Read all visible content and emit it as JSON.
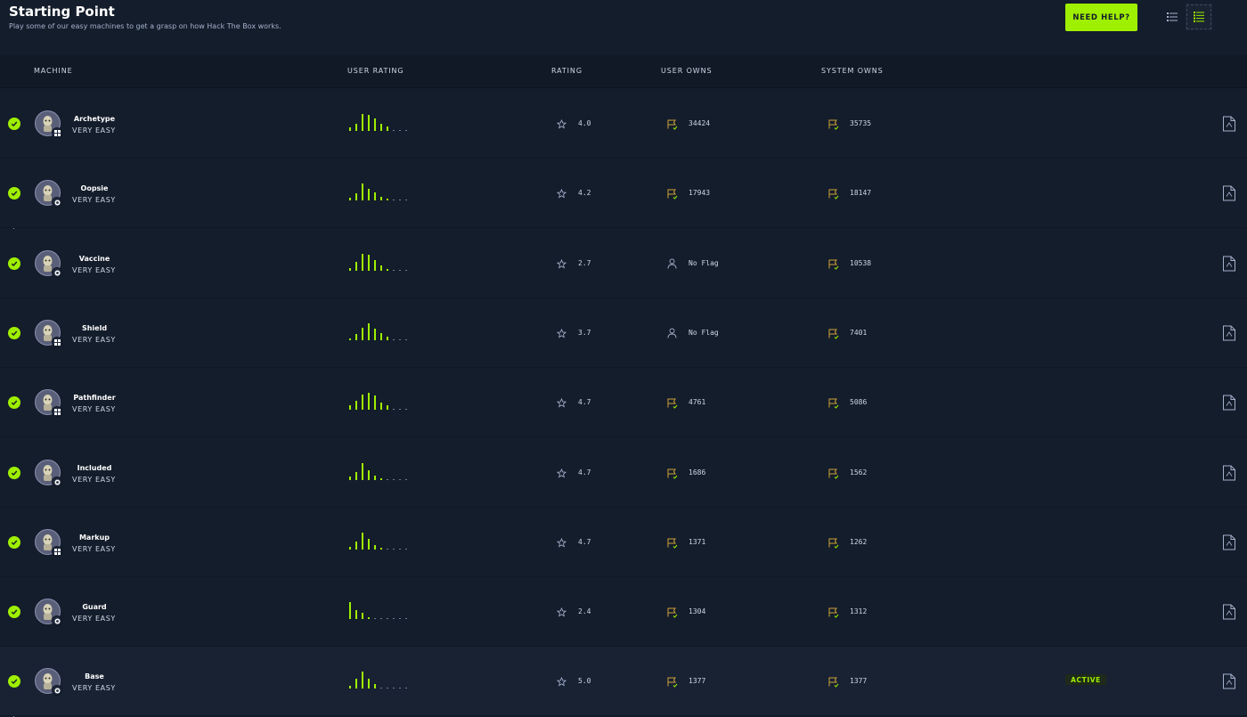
{
  "header": {
    "title": "Starting Point",
    "subtitle": "Play some of our easy machines to get a grasp on how Hack The Box works.",
    "help_label": "NEED HELP?"
  },
  "table": {
    "columns": [
      "MACHINE",
      "USER RATING",
      "RATING",
      "USER OWNS",
      "SYSTEM OWNS"
    ]
  },
  "colors": {
    "accent": "#9fef00",
    "background": "#141d2b",
    "flag": "#cfa23a"
  },
  "machines": [
    {
      "name": "Archetype",
      "difficulty": "VERY EASY",
      "os": "windows",
      "rating": "4.0",
      "user_owns": "34424",
      "user_flag": true,
      "system_owns": "35735",
      "active": false,
      "rating_distribution": [
        0.22,
        0.4,
        0.95,
        0.9,
        0.7,
        0.4,
        0.25,
        0,
        0,
        0
      ]
    },
    {
      "name": "Oopsie",
      "difficulty": "VERY EASY",
      "os": "linux",
      "rating": "4.2",
      "user_owns": "17943",
      "user_flag": true,
      "system_owns": "18147",
      "active": false,
      "rating_distribution": [
        0.15,
        0.4,
        0.95,
        0.65,
        0.45,
        0.2,
        0.1,
        0,
        0,
        0
      ]
    },
    {
      "name": "Vaccine",
      "difficulty": "VERY EASY",
      "os": "linux",
      "rating": "2.7",
      "user_owns": "No Flag",
      "user_flag": false,
      "system_owns": "10538",
      "active": false,
      "rating_distribution": [
        0.15,
        0.5,
        0.95,
        0.9,
        0.6,
        0.3,
        0.12,
        0,
        0,
        0
      ]
    },
    {
      "name": "Shield",
      "difficulty": "VERY EASY",
      "os": "windows",
      "rating": "3.7",
      "user_owns": "No Flag",
      "user_flag": false,
      "system_owns": "7401",
      "active": false,
      "rating_distribution": [
        0.1,
        0.35,
        0.7,
        0.95,
        0.65,
        0.4,
        0.2,
        0,
        0,
        0
      ]
    },
    {
      "name": "Pathfinder",
      "difficulty": "VERY EASY",
      "os": "windows",
      "rating": "4.7",
      "user_owns": "4761",
      "user_flag": true,
      "system_owns": "5086",
      "active": false,
      "rating_distribution": [
        0.25,
        0.5,
        0.85,
        0.95,
        0.8,
        0.4,
        0.25,
        0,
        0,
        0
      ]
    },
    {
      "name": "Included",
      "difficulty": "VERY EASY",
      "os": "linux",
      "rating": "4.7",
      "user_owns": "1686",
      "user_flag": true,
      "system_owns": "1562",
      "active": false,
      "rating_distribution": [
        0.2,
        0.45,
        0.95,
        0.55,
        0.25,
        0.1,
        0,
        0,
        0,
        0
      ]
    },
    {
      "name": "Markup",
      "difficulty": "VERY EASY",
      "os": "windows",
      "rating": "4.7",
      "user_owns": "1371",
      "user_flag": true,
      "system_owns": "1262",
      "active": false,
      "rating_distribution": [
        0.15,
        0.45,
        0.95,
        0.6,
        0.25,
        0.1,
        0,
        0,
        0,
        0
      ]
    },
    {
      "name": "Guard",
      "difficulty": "VERY EASY",
      "os": "linux",
      "rating": "2.4",
      "user_owns": "1304",
      "user_flag": true,
      "system_owns": "1312",
      "active": false,
      "rating_distribution": [
        0.95,
        0.5,
        0.35,
        0.12,
        0,
        0,
        0,
        0,
        0,
        0
      ]
    },
    {
      "name": "Base",
      "difficulty": "VERY EASY",
      "os": "linux",
      "rating": "5.0",
      "user_owns": "1377",
      "user_flag": true,
      "system_owns": "1377",
      "active": true,
      "active_label": "ACTIVE",
      "rating_distribution": [
        0.15,
        0.55,
        0.95,
        0.55,
        0.25,
        0,
        0,
        0,
        0,
        0
      ]
    }
  ]
}
